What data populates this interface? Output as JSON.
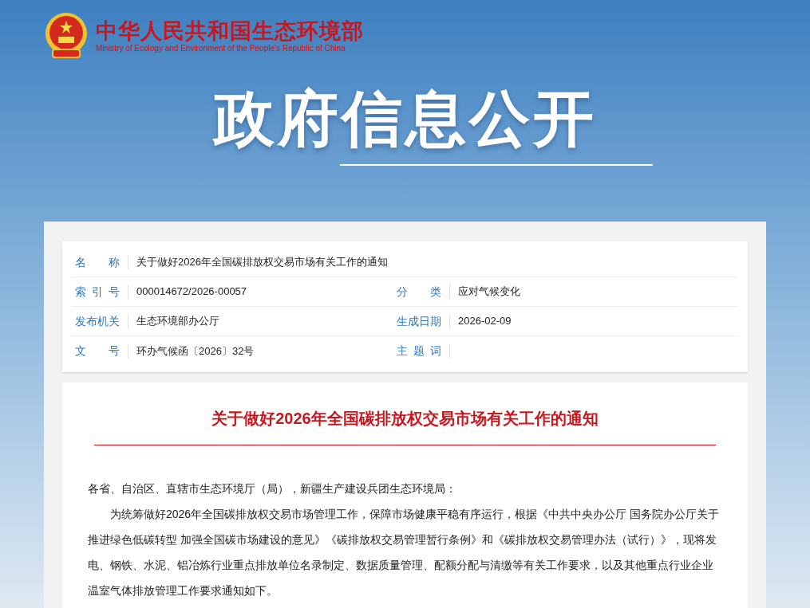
{
  "site": {
    "name": "中华人民共和国生态环境部",
    "name_en": "Ministry of Ecology and Environment of the People's Republic of China"
  },
  "banner": {
    "title": "政府信息公开"
  },
  "info": {
    "rows": [
      {
        "cells": [
          {
            "label": "名称",
            "value": "关于做好2026年全国碳排放权交易市场有关工作的通知"
          }
        ]
      },
      {
        "cells": [
          {
            "label": "索引号",
            "value": "000014672/2026-00057"
          },
          {
            "label": "分类",
            "value": "应对气候变化"
          }
        ]
      },
      {
        "cells": [
          {
            "label": "发布机关",
            "value": "生态环境部办公厅"
          },
          {
            "label": "生成日期",
            "value": "2026-02-09"
          }
        ]
      },
      {
        "cells": [
          {
            "label": "文号",
            "value": "环办气候函〔2026〕32号"
          },
          {
            "label": "主题词"
          }
        ]
      }
    ]
  },
  "article": {
    "title": "关于做好2026年全国碳排放权交易市场有关工作的通知",
    "salutation": "各省、自治区、直辖市生态环境厅（局），新疆生产建设兵团生态环境局：",
    "paragraphs": [
      "为统筹做好2026年全国碳排放权交易市场管理工作，保障市场健康平稳有序运行，根据《中共中央办公厅 国务院办公厅关于推进绿色低碳转型 加强全国碳市场建设的意见》《碳排放权交易管理暂行条例》和《碳排放权交易管理办法（试行）》，现将发电、钢铁、水泥、铝冶炼行业重点排放单位名录制定、数据质量管理、配额分配与清缴等有关工作要求，以及其他重点行业企业温室气体排放管理工作要求通知如下。"
    ]
  }
}
